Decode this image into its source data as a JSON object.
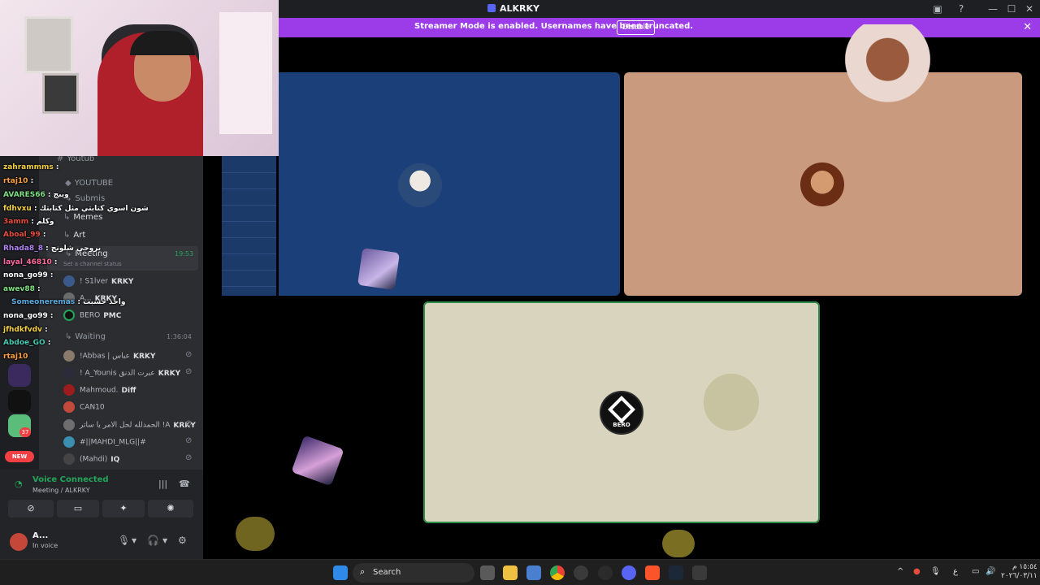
{
  "window": {
    "title": "ALKRKY"
  },
  "banner": {
    "message": "Streamer Mode is enabled. Usernames have been truncated.",
    "disable_label": "Disable"
  },
  "channels": [
    {
      "name": "Youtub"
    },
    {
      "name": "YOUTUBE"
    },
    {
      "name": "Submis"
    },
    {
      "name": "Memes"
    },
    {
      "name": "Art"
    },
    {
      "name": "Meeting"
    }
  ],
  "meeting": {
    "time": "19:53",
    "status_placeholder": "Set a channel status"
  },
  "voice_users": [
    {
      "name": "! S1lver",
      "tag": "KRKY"
    },
    {
      "name": "A...",
      "tag": "KRKY"
    },
    {
      "name": "BERO",
      "tag": "PMC"
    }
  ],
  "waiting": {
    "name": "Waiting",
    "time": "1:36:04"
  },
  "waiting_users": [
    {
      "name": "!Abbas | عباس",
      "tag": "KRKY"
    },
    {
      "name": "! A_Younis عبرت الدنق",
      "tag": "KRKY"
    },
    {
      "name": "Mahmoud.",
      "tag": "Diff"
    },
    {
      "name": "CAN10",
      "tag": ""
    },
    {
      "name": "الحمدلله لحل الامر يا ساتر !A",
      "tag": "KRKY"
    },
    {
      "name": "#||MAHDI_MLG||#",
      "tag": ""
    },
    {
      "name": "(Mahdi)",
      "tag": "IQ"
    }
  ],
  "server_badges": {
    "new_label": "NEW",
    "count_label": "37"
  },
  "chat_lines": [
    {
      "user": "zahrammms",
      "text": ":",
      "color": "#f4d03f"
    },
    {
      "user": "rtaj10",
      "text": ":",
      "color": "#ff9f43"
    },
    {
      "user": "AVARES66",
      "text": ": ويبج",
      "color": "#7ee081"
    },
    {
      "user": "fdhvxu",
      "text": ": شون اسوي كتابتي مثل كتابتك",
      "color": "#f4d03f"
    },
    {
      "user": "3amm",
      "text": ": وكلم",
      "color": "#e74c3c"
    },
    {
      "user": "Aboal_99",
      "text": ":",
      "color": "#e74c3c"
    },
    {
      "user": "Rhada8_8",
      "text": ": بروحي شلونج",
      "color": "#b084f5"
    },
    {
      "user": "layal_46810",
      "text": ":",
      "color": "#ff6b9d"
    },
    {
      "user": "nona_go99",
      "text": ":",
      "color": "#ffffff"
    },
    {
      "user": "awev88",
      "text": ":",
      "color": "#7ee081"
    },
    {
      "user": "Someoneremas",
      "text": ": واحد حسبت",
      "color": "#5dade2"
    },
    {
      "user": "nona_go99",
      "text": ":",
      "color": "#ffffff"
    },
    {
      "user": "jfhdkfvdv",
      "text": ":",
      "color": "#f4d03f"
    },
    {
      "user": "Abdoe_GO",
      "text": ":",
      "color": "#48c9b0"
    },
    {
      "user": "rtaj10",
      "text": "",
      "color": "#ff9f43"
    }
  ],
  "voice_panel": {
    "status": "Voice Connected",
    "location": "Meeting / ALKRKY"
  },
  "user": {
    "name": "A...",
    "status": "In voice"
  },
  "stage": {
    "bero_label": "BERO"
  },
  "taskbar": {
    "search_label": "Search",
    "tray_lang": "ع",
    "time": "١٥:٥٤ م",
    "date": "٢٠٢٦/٠٣/١١"
  },
  "colors": {
    "banner": "#9b3ce8",
    "tile_blue": "#1b3f78",
    "tile_tan": "#c99a7e",
    "tile_cream": "#d9d4bd",
    "speaking_border": "#2f8f4a",
    "voice_green": "#23a55a"
  }
}
